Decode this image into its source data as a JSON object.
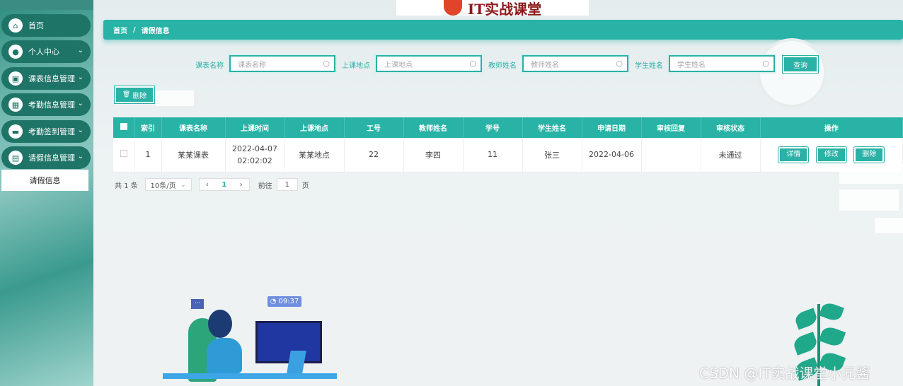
{
  "sidebar": {
    "items": [
      {
        "label": "首页",
        "icon": "home-icon",
        "glyph": "⌂"
      },
      {
        "label": "个人中心",
        "icon": "user-icon",
        "glyph": "●"
      },
      {
        "label": "课表信息管理",
        "icon": "briefcase-icon",
        "glyph": "▣"
      },
      {
        "label": "考勤信息管理",
        "icon": "grid-icon",
        "glyph": "▦"
      },
      {
        "label": "考勤签到管理",
        "icon": "chat-icon",
        "glyph": "▬"
      },
      {
        "label": "请假信息管理",
        "icon": "document-icon",
        "glyph": "▤"
      }
    ],
    "sub_item": "请假信息",
    "chevron": "⌄"
  },
  "banner": {
    "text": "IT实战课堂"
  },
  "breadcrumb": {
    "home": "首页",
    "sep": "/",
    "current": "请假信息"
  },
  "filters": [
    {
      "label": "课表名称",
      "placeholder": "课表名称"
    },
    {
      "label": "上课地点",
      "placeholder": "上课地点"
    },
    {
      "label": "教师姓名",
      "placeholder": "教师姓名"
    },
    {
      "label": "学生姓名",
      "placeholder": "学生姓名"
    }
  ],
  "search_glyph": "○",
  "buttons": {
    "query": "查询",
    "delete": "删除",
    "delete_glyph": "🗑"
  },
  "table": {
    "headers": [
      "索引",
      "课表名称",
      "上课时间",
      "上课地点",
      "工号",
      "教师姓名",
      "学号",
      "学生姓名",
      "申请日期",
      "审核回复",
      "审核状态",
      "操作"
    ],
    "rows": [
      {
        "index": "1",
        "course": "某某课表",
        "time": "2022-04-07 02:02:02",
        "place": "某某地点",
        "teacher_id": "22",
        "teacher": "李四",
        "student_id": "11",
        "student": "张三",
        "date": "2022-04-06",
        "reply": "",
        "status": "未通过"
      }
    ],
    "actions": {
      "detail": "详情",
      "edit": "修改",
      "delete": "删除"
    }
  },
  "pagination": {
    "total": "共 1 条",
    "page_size": "10条/页",
    "prev": "‹",
    "current": "1",
    "next": "›",
    "goto": "前往",
    "goto_value": "1",
    "unit": "页"
  },
  "illustration": {
    "time": "09:37",
    "chat": "···"
  },
  "watermark": "CSDN @IT实战课堂小元酱",
  "colors": {
    "accent": "#29b2a6",
    "sidebar_item": "#1f7468"
  }
}
